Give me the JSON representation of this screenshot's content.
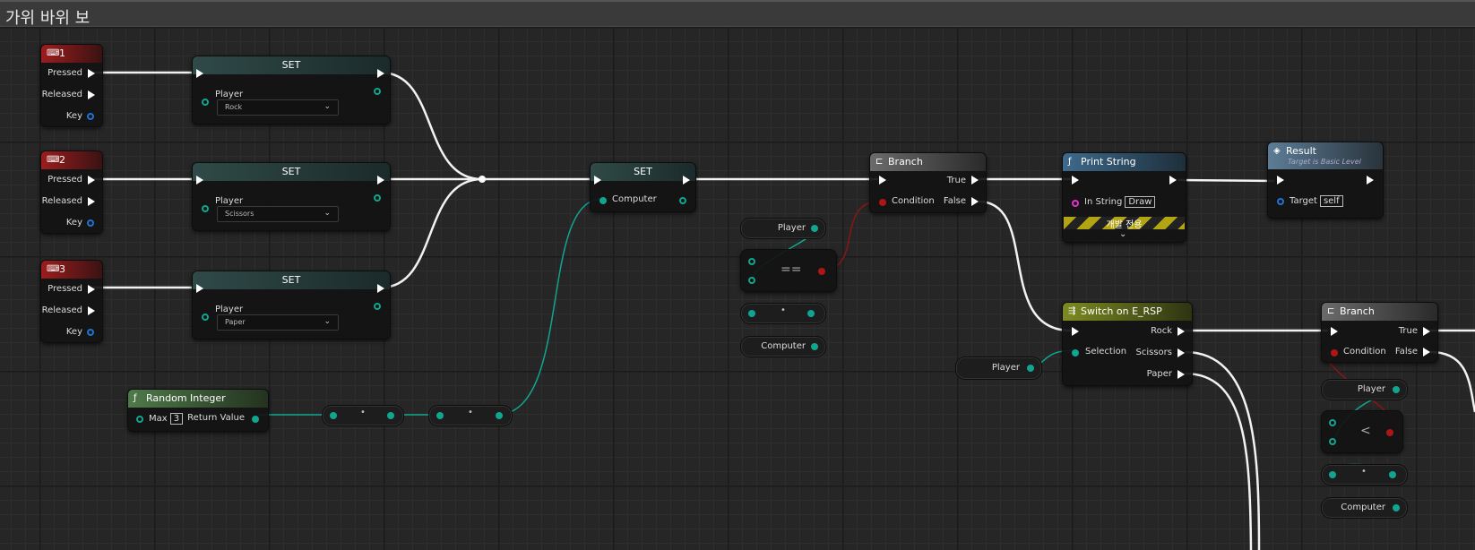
{
  "window": {
    "title": "가위 바위 보"
  },
  "key_events": [
    {
      "label": "1",
      "pins": {
        "pressed": "Pressed",
        "released": "Released",
        "key": "Key"
      }
    },
    {
      "label": "2",
      "pins": {
        "pressed": "Pressed",
        "released": "Released",
        "key": "Key"
      }
    },
    {
      "label": "3",
      "pins": {
        "pressed": "Pressed",
        "released": "Released",
        "key": "Key"
      }
    }
  ],
  "set_player_nodes": [
    {
      "title": "SET",
      "var": "Player",
      "value": "Rock"
    },
    {
      "title": "SET",
      "var": "Player",
      "value": "Scissors"
    },
    {
      "title": "SET",
      "var": "Player",
      "value": "Paper"
    }
  ],
  "set_computer": {
    "title": "SET",
    "var": "Computer"
  },
  "random_integer": {
    "title": "Random Integer",
    "max_label": "Max",
    "max_value": "3",
    "return_label": "Return Value"
  },
  "branch1": {
    "title": "Branch",
    "true_label": "True",
    "false_label": "False",
    "condition_label": "Condition"
  },
  "print_string": {
    "title": "Print String",
    "in_string_label": "In String",
    "in_string_value": "Draw",
    "dev_only": "개발 전용"
  },
  "result": {
    "title": "Result",
    "subtitle": "Target is Basic Level",
    "target_label": "Target",
    "target_value": "self"
  },
  "compare1": {
    "var_a": "Player",
    "op": "==",
    "var_b": "Computer"
  },
  "switch": {
    "title": "Switch on E_RSP",
    "selection_label": "Selection",
    "rock": "Rock",
    "scissors": "Scissors",
    "paper": "Paper",
    "input_var": "Player"
  },
  "branch2": {
    "title": "Branch",
    "true_label": "True",
    "false_label": "False",
    "condition_label": "Condition"
  },
  "compare2": {
    "var_a": "Player",
    "op": "<",
    "var_b": "Computer"
  }
}
